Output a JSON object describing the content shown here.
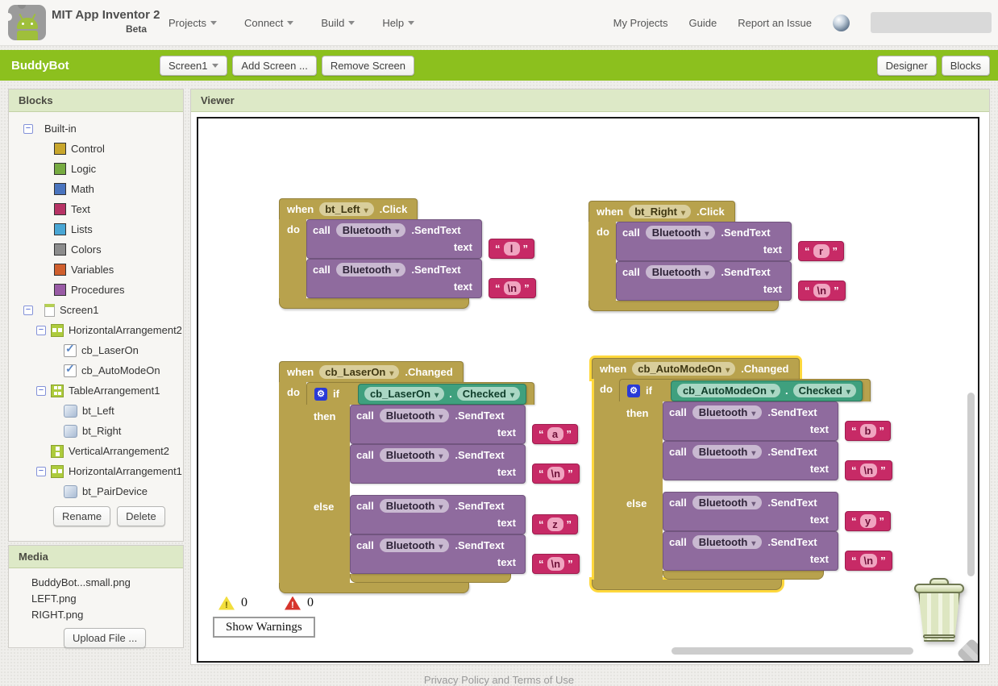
{
  "colors": {
    "appbar_green": "#8CC01E",
    "panel_header_green": "#dde9c7",
    "block_gold": "#B8A24D",
    "block_purple": "#8F6B9E",
    "block_pink": "#C72A66",
    "block_teal_green": "#3FA07E",
    "selected_outline": "#FFD83C"
  },
  "header": {
    "app_title": "MIT App Inventor 2",
    "beta": "Beta",
    "menus": [
      {
        "label": "Projects"
      },
      {
        "label": "Connect"
      },
      {
        "label": "Build"
      },
      {
        "label": "Help"
      }
    ],
    "links": [
      {
        "label": "My Projects"
      },
      {
        "label": "Guide"
      },
      {
        "label": "Report an Issue"
      }
    ]
  },
  "toolbar": {
    "project_name": "BuddyBot",
    "screen_button": "Screen1",
    "add_screen": "Add Screen ...",
    "remove_screen": "Remove Screen",
    "designer": "Designer",
    "blocks": "Blocks"
  },
  "palette": {
    "title": "Blocks",
    "builtin_label": "Built-in",
    "categories": [
      {
        "label": "Control",
        "color": "#C8A62C"
      },
      {
        "label": "Logic",
        "color": "#77AB41"
      },
      {
        "label": "Math",
        "color": "#4A74BE"
      },
      {
        "label": "Text",
        "color": "#B73365"
      },
      {
        "label": "Lists",
        "color": "#49A6D4"
      },
      {
        "label": "Colors",
        "color": "#8C8C8C"
      },
      {
        "label": "Variables",
        "color": "#D05F2D"
      },
      {
        "label": "Procedures",
        "color": "#995BA5"
      }
    ],
    "screen_label": "Screen1",
    "tree": [
      {
        "label": "HorizontalArrangement2"
      },
      {
        "label": "cb_LaserOn"
      },
      {
        "label": "cb_AutoModeOn"
      },
      {
        "label": "TableArrangement1"
      },
      {
        "label": "bt_Left"
      },
      {
        "label": "bt_Right"
      },
      {
        "label": "VerticalArrangement2"
      },
      {
        "label": "HorizontalArrangement1"
      },
      {
        "label": "bt_PairDevice"
      }
    ],
    "rename_button": "Rename",
    "delete_button": "Delete"
  },
  "media": {
    "title": "Media",
    "files": [
      {
        "name": "BuddyBot...small.png"
      },
      {
        "name": "LEFT.png"
      },
      {
        "name": "RIGHT.png"
      }
    ],
    "upload_button": "Upload File ..."
  },
  "viewer": {
    "title": "Viewer",
    "warning_count": "0",
    "error_count": "0",
    "show_warnings_button": "Show Warnings"
  },
  "workspace": {
    "groups": [
      {
        "when": "when",
        "component": "bt_Left",
        "event": ".Click",
        "do_label": "do",
        "calls": [
          {
            "call": "call",
            "component": "Bluetooth",
            "method": ".SendText",
            "param": "text",
            "value": "l"
          },
          {
            "call": "call",
            "component": "Bluetooth",
            "method": ".SendText",
            "param": "text",
            "value": "\\n"
          }
        ]
      },
      {
        "when": "when",
        "component": "bt_Right",
        "event": ".Click",
        "do_label": "do",
        "calls": [
          {
            "call": "call",
            "component": "Bluetooth",
            "method": ".SendText",
            "param": "text",
            "value": "r"
          },
          {
            "call": "call",
            "component": "Bluetooth",
            "method": ".SendText",
            "param": "text",
            "value": "\\n"
          }
        ]
      },
      {
        "when": "when",
        "component": "cb_LaserOn",
        "event": ".Changed",
        "do_label": "do",
        "if_label": "if",
        "then_label": "then",
        "else_label": "else",
        "condition": {
          "component": "cb_LaserOn",
          "dot": ".",
          "property": "Checked"
        },
        "then_calls": [
          {
            "call": "call",
            "component": "Bluetooth",
            "method": ".SendText",
            "param": "text",
            "value": "a"
          },
          {
            "call": "call",
            "component": "Bluetooth",
            "method": ".SendText",
            "param": "text",
            "value": "\\n"
          }
        ],
        "else_calls": [
          {
            "call": "call",
            "component": "Bluetooth",
            "method": ".SendText",
            "param": "text",
            "value": "z"
          },
          {
            "call": "call",
            "component": "Bluetooth",
            "method": ".SendText",
            "param": "text",
            "value": "\\n"
          }
        ]
      },
      {
        "when": "when",
        "component": "cb_AutoModeOn",
        "event": ".Changed",
        "do_label": "do",
        "if_label": "if",
        "then_label": "then",
        "else_label": "else",
        "condition": {
          "component": "cb_AutoModeOn",
          "dot": ".",
          "property": "Checked"
        },
        "then_calls": [
          {
            "call": "call",
            "component": "Bluetooth",
            "method": ".SendText",
            "param": "text",
            "value": "b"
          },
          {
            "call": "call",
            "component": "Bluetooth",
            "method": ".SendText",
            "param": "text",
            "value": "\\n"
          }
        ],
        "else_calls": [
          {
            "call": "call",
            "component": "Bluetooth",
            "method": ".SendText",
            "param": "text",
            "value": "y"
          },
          {
            "call": "call",
            "component": "Bluetooth",
            "method": ".SendText",
            "param": "text",
            "value": "\\n"
          }
        ],
        "selected": true
      }
    ]
  },
  "footer": {
    "text": "Privacy Policy and Terms of Use"
  }
}
